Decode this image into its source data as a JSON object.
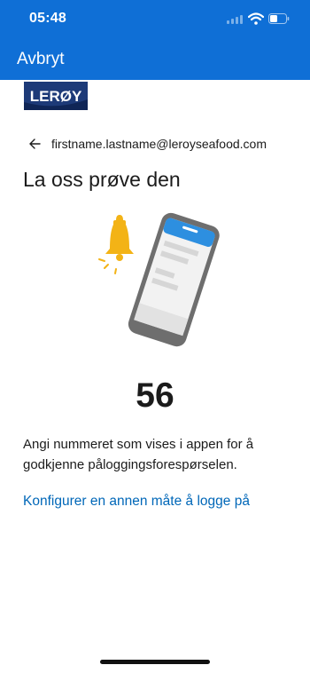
{
  "status_bar": {
    "time": "05:48"
  },
  "header": {
    "cancel_label": "Avbryt",
    "color": "#0f6fd6"
  },
  "logo": {
    "text": "LERØY"
  },
  "account": {
    "email": "firstname.lastname@leroyseafood.com"
  },
  "main": {
    "title": "La oss prøve den",
    "number": "56",
    "description": "Angi nummeret som vises i appen for å godkjenne påloggingsforespørselen.",
    "alt_method_link": "Konfigurer en annen måte å logge på"
  },
  "colors": {
    "link": "#0067b8",
    "bell": "#f3b316",
    "phone_frame": "#6e6e6e",
    "phone_header": "#2d8fe0"
  }
}
